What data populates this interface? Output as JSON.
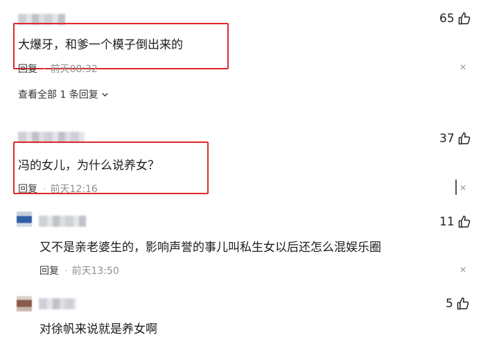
{
  "comments": [
    {
      "text": "大爆牙，和爹一个模子倒出来的",
      "reply_label": "回复",
      "time": "前天08:32",
      "likes": "65"
    },
    {
      "text": "冯的女儿，为什么说养女？",
      "reply_label": "回复",
      "time": "前天12:16",
      "likes": "37"
    },
    {
      "text": "又不是亲老婆生的，影响声誉的事儿叫私生女以后还怎么混娱乐圈",
      "reply_label": "回复",
      "time": "前天13:50",
      "likes": "11"
    },
    {
      "text": "对徐帆来说就是养女啊",
      "likes": "5"
    }
  ],
  "view_all_replies": "查看全部 1 条回复",
  "icons": {
    "like": "thumbs-up-icon",
    "close": "close-icon",
    "expand": "chevron-down-icon"
  },
  "colors": {
    "highlight_box": "#e0252b",
    "time_text": "#8f8f8f"
  }
}
